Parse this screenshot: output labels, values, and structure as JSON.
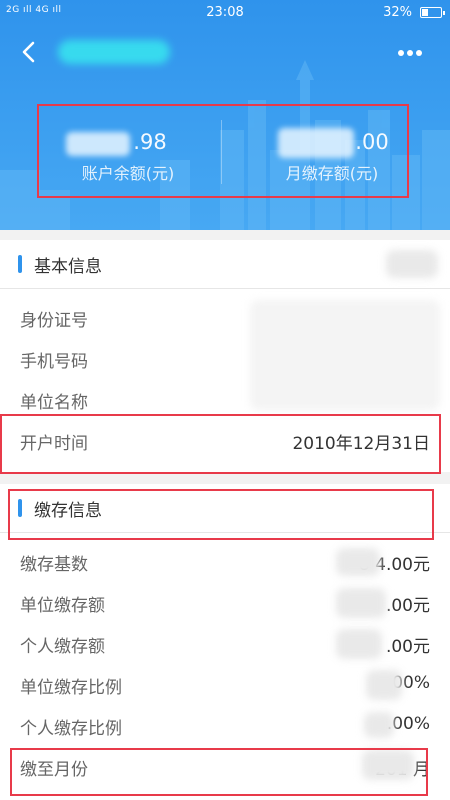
{
  "status_bar": {
    "signal_text": "2G ıll 4G ıll",
    "time": "23:08",
    "battery": "32%"
  },
  "nav": {
    "back_icon": "chevron-left-icon",
    "more_icon": "more-dots-icon"
  },
  "balances": {
    "account_balance_value": ".98",
    "account_balance_label": "账户余额(元)",
    "monthly_payment_value": ".00",
    "monthly_payment_label": "月缴存额(元)"
  },
  "basic_info": {
    "title": "基本信息",
    "rows": [
      {
        "label": "身份证号",
        "value": ""
      },
      {
        "label": "手机号码",
        "value": ""
      },
      {
        "label": "单位名称",
        "value": ""
      },
      {
        "label": "开户时间",
        "value": "2010年12月31日"
      }
    ]
  },
  "deposit_info": {
    "title": "缴存信息",
    "rows": [
      {
        "label": "缴存基数",
        "value": "8   4.00元"
      },
      {
        "label": "单位缴存额",
        "value": ".00元"
      },
      {
        "label": "个人缴存额",
        "value": ".00元"
      },
      {
        "label": "单位缴存比例",
        "value": "00%"
      },
      {
        "label": "个人缴存比例",
        "value": ".00%"
      },
      {
        "label": "缴至月份",
        "value": "201     月"
      }
    ]
  },
  "colors": {
    "header_blue": "#2f93ec",
    "highlight_red": "#e83a4a"
  }
}
